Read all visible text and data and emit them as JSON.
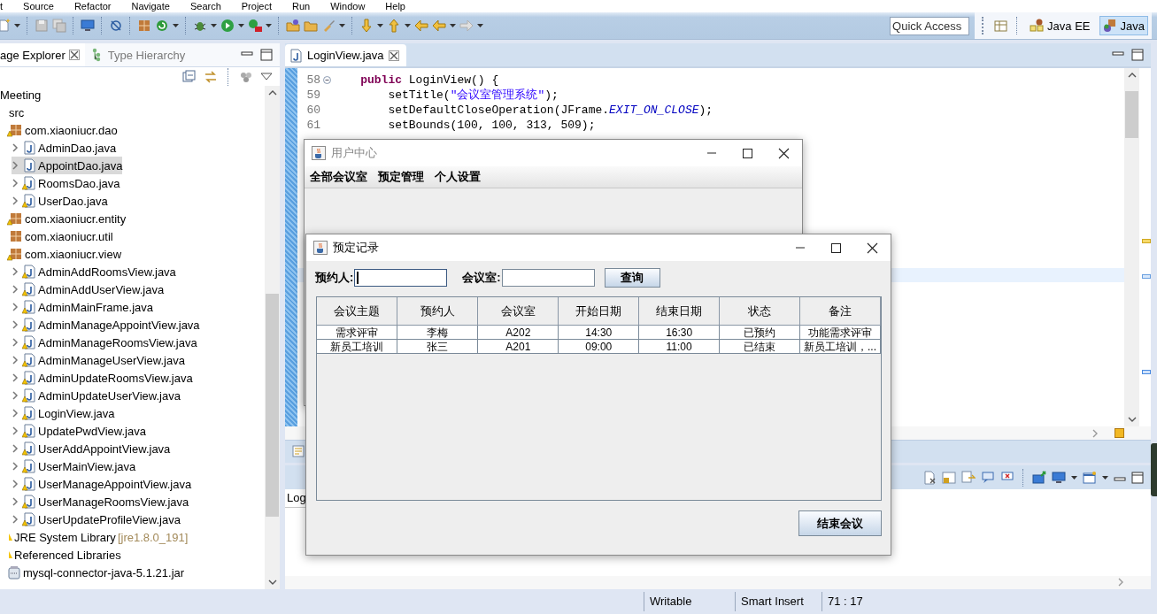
{
  "menu_bar": {
    "items": [
      "t",
      "Source",
      "Refactor",
      "Navigate",
      "Search",
      "Project",
      "Run",
      "Window",
      "Help"
    ]
  },
  "toolbar": {
    "quick_access": {
      "placeholder": "Quick Access"
    },
    "perspectives": [
      {
        "label": "Java EE",
        "selected": false
      },
      {
        "label": "Java",
        "selected": true
      }
    ]
  },
  "package_explorer": {
    "tabs": [
      {
        "label": "age Explorer",
        "selected": true
      },
      {
        "label": "Type Hierarchy",
        "selected": false
      }
    ],
    "tree": [
      {
        "label": "Meeting",
        "selected": false,
        "children": [
          {
            "label": "src",
            "selected": false,
            "children": [
              {
                "kind": "package",
                "label": "com.xiaoniucr.dao",
                "warning": true,
                "selected": false,
                "children": [
                  {
                    "kind": "file",
                    "label": "AdminDao.java",
                    "warning": false,
                    "expanded": false,
                    "selected": false
                  },
                  {
                    "kind": "file",
                    "label": "AppointDao.java",
                    "warning": false,
                    "expanded": false,
                    "selected": true
                  },
                  {
                    "kind": "file",
                    "label": "RoomsDao.java",
                    "warning": true,
                    "expanded": false,
                    "selected": false
                  },
                  {
                    "kind": "file",
                    "label": "UserDao.java",
                    "warning": true,
                    "expanded": false,
                    "selected": false
                  }
                ]
              },
              {
                "kind": "package",
                "label": "com.xiaoniucr.entity",
                "warning": true,
                "selected": false
              },
              {
                "kind": "package",
                "label": "com.xiaoniucr.util",
                "warning": false,
                "selected": false
              },
              {
                "kind": "package",
                "label": "com.xiaoniucr.view",
                "warning": true,
                "selected": false,
                "children": [
                  {
                    "kind": "file",
                    "label": "AdminAddRoomsView.java",
                    "warning": true,
                    "expanded": false,
                    "selected": false
                  },
                  {
                    "kind": "file",
                    "label": "AdminAddUserView.java",
                    "warning": true,
                    "expanded": false,
                    "selected": false
                  },
                  {
                    "kind": "file",
                    "label": "AdminMainFrame.java",
                    "warning": true,
                    "expanded": false,
                    "selected": false
                  },
                  {
                    "kind": "file",
                    "label": "AdminManageAppointView.java",
                    "warning": true,
                    "expanded": false,
                    "selected": false
                  },
                  {
                    "kind": "file",
                    "label": "AdminManageRoomsView.java",
                    "warning": true,
                    "expanded": false,
                    "selected": false
                  },
                  {
                    "kind": "file",
                    "label": "AdminManageUserView.java",
                    "warning": true,
                    "expanded": false,
                    "selected": false
                  },
                  {
                    "kind": "file",
                    "label": "AdminUpdateRoomsView.java",
                    "warning": true,
                    "expanded": false,
                    "selected": false
                  },
                  {
                    "kind": "file",
                    "label": "AdminUpdateUserView.java",
                    "warning": true,
                    "expanded": false,
                    "selected": false
                  },
                  {
                    "kind": "file",
                    "label": "LoginView.java",
                    "warning": true,
                    "expanded": false,
                    "selected": false
                  },
                  {
                    "kind": "file",
                    "label": "UpdatePwdView.java",
                    "warning": true,
                    "expanded": false,
                    "selected": false
                  },
                  {
                    "kind": "file",
                    "label": "UserAddAppointView.java",
                    "warning": true,
                    "expanded": false,
                    "selected": false
                  },
                  {
                    "kind": "file",
                    "label": "UserMainView.java",
                    "warning": true,
                    "expanded": false,
                    "selected": false
                  },
                  {
                    "kind": "file",
                    "label": "UserManageAppointView.java",
                    "warning": true,
                    "expanded": false,
                    "selected": false
                  },
                  {
                    "kind": "file",
                    "label": "UserManageRoomsView.java",
                    "warning": true,
                    "expanded": false,
                    "selected": false
                  },
                  {
                    "kind": "file",
                    "label": "UserUpdateProfileView.java",
                    "warning": true,
                    "expanded": false,
                    "selected": false
                  }
                ]
              }
            ]
          },
          {
            "label": "JRE System Library",
            "suffix": "[jre1.8.0_191]",
            "warning": true,
            "selected": false
          },
          {
            "label": "Referenced Libraries",
            "warning": true,
            "selected": false,
            "children": [
              {
                "kind": "jar",
                "label": "mysql-connector-java-5.1.21.jar",
                "selected": false
              }
            ]
          }
        ]
      }
    ]
  },
  "editor": {
    "tabs": [
      {
        "label": "LoginView.java",
        "selected": true
      }
    ],
    "lines": [
      {
        "number": "58",
        "fold": true,
        "segments": [
          {
            "kind": "keyword",
            "text": "    public"
          },
          {
            "kind": "plain",
            "text": " LoginView() {"
          }
        ]
      },
      {
        "number": "59",
        "fold": false,
        "segments": [
          {
            "kind": "plain",
            "text": "        setTitle("
          },
          {
            "kind": "string",
            "text": "\"会议室管理系统\""
          },
          {
            "kind": "plain",
            "text": ");"
          }
        ]
      },
      {
        "number": "60",
        "fold": false,
        "segments": [
          {
            "kind": "plain",
            "text": "        setDefaultCloseOperation(JFrame."
          },
          {
            "kind": "field",
            "text": "EXIT_ON_CLOSE"
          },
          {
            "kind": "plain",
            "text": ");"
          }
        ]
      },
      {
        "number": "61",
        "fold": false,
        "segments": [
          {
            "kind": "plain",
            "text": "        setBounds(100, 100, 313, 509);"
          }
        ]
      }
    ]
  },
  "bottom_panel": {
    "tab_label": "Log"
  },
  "status_bar": {
    "items": [
      "Writable",
      "Smart Insert",
      "71 : 17"
    ]
  },
  "user_center_window": {
    "title": "用户中心",
    "active": false,
    "menu": [
      "全部会议室",
      "预定管理",
      "个人设置"
    ]
  },
  "record_dialog": {
    "title": "预定记录",
    "active": true,
    "filters": [
      {
        "label": "预约人:",
        "focused": true
      },
      {
        "label": "会议室:",
        "focused": false
      }
    ],
    "search_button": "查询",
    "table": {
      "columns": [
        "会议主题",
        "预约人",
        "会议室",
        "开始日期",
        "结束日期",
        "状态",
        "备注"
      ],
      "rows": [
        {
          "cells": [
            "需求评审",
            "李梅",
            "A202",
            "14:30",
            "16:30",
            "已预约",
            "功能需求评审"
          ],
          "selected": false
        },
        {
          "cells": [
            "新员工培训",
            "张三",
            "A201",
            "09:00",
            "11:00",
            "已结束",
            "新员工培训，..."
          ],
          "selected": false
        }
      ]
    },
    "end_button": "结束会议"
  }
}
